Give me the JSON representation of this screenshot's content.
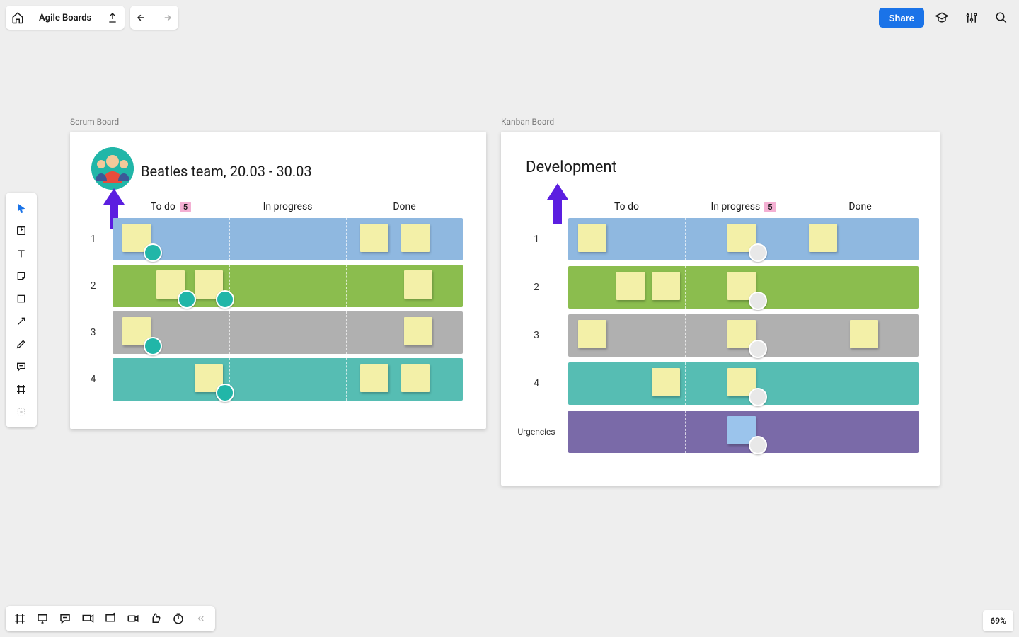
{
  "header": {
    "title": "Agile Boards",
    "share_label": "Share"
  },
  "zoom": {
    "display": "69%"
  },
  "frames": {
    "scrum": {
      "label": "Scrum Board",
      "title": "Beatles team, 20.03 - 30.03",
      "columns": [
        "To do",
        "In progress",
        "Done"
      ],
      "wip_badge": "5",
      "rows": [
        "1",
        "2",
        "3",
        "4"
      ]
    },
    "kanban": {
      "label": "Kanban Board",
      "title": "Development",
      "columns": [
        "To do",
        "In progress",
        "Done"
      ],
      "wip_badge": "5",
      "rows": [
        "1",
        "2",
        "3",
        "4",
        "Urgencies"
      ]
    }
  },
  "icons": {
    "home": "home-icon",
    "export": "export-icon",
    "undo": "undo-icon",
    "redo": "redo-icon",
    "grad": "graduation-cap-icon",
    "settings": "sliders-icon",
    "search": "search-icon",
    "cursor": "cursor-icon",
    "templates": "templates-icon",
    "text": "text-icon",
    "sticky": "sticky-note-icon",
    "shape": "rectangle-icon",
    "line": "arrow-icon",
    "pen": "pen-icon",
    "comment": "comment-icon",
    "frame": "frame-icon",
    "more": "more-apps-icon",
    "frames": "frames-icon",
    "present": "presentation-icon",
    "comments": "comments-icon",
    "screenshare": "screen-share-icon",
    "embed": "embed-icon",
    "video": "video-icon",
    "reaction": "thumbs-up-icon",
    "timer": "timer-icon",
    "collapse": "collapse-icon"
  }
}
